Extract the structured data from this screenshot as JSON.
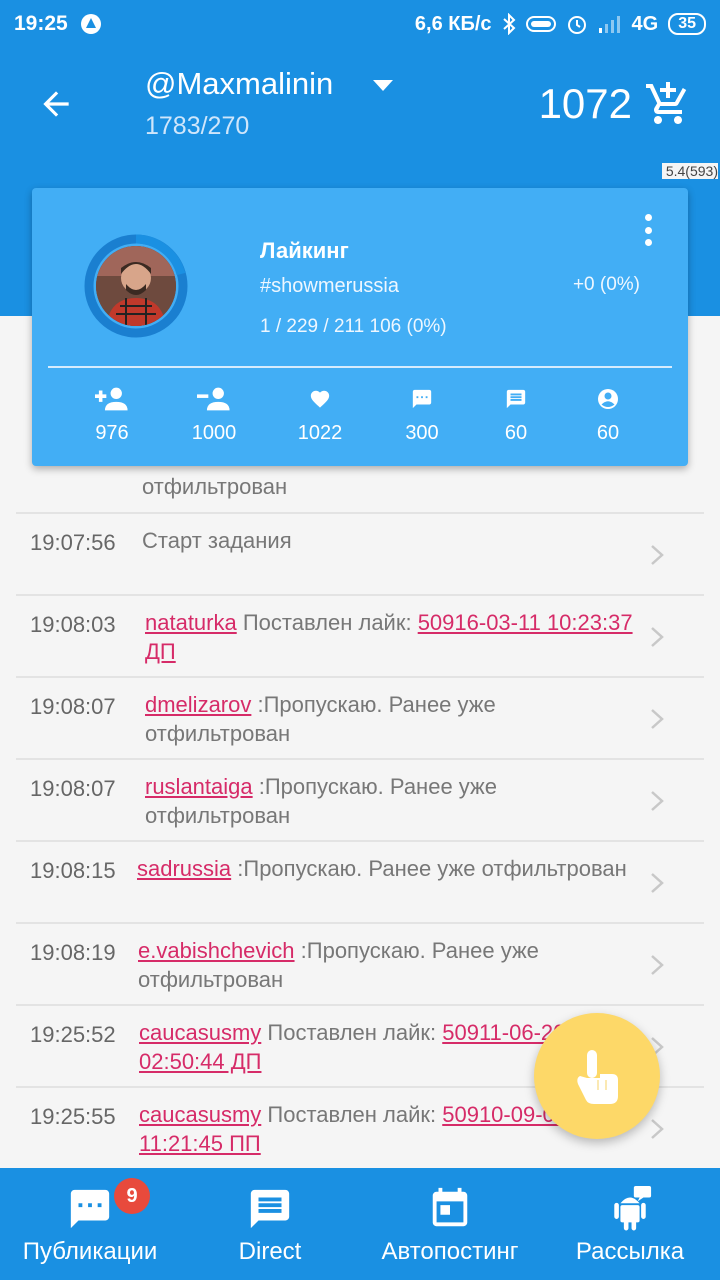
{
  "status_bar": {
    "time": "19:25",
    "network_speed": "6,6 КБ/с",
    "network_type": "4G",
    "battery": "35"
  },
  "header": {
    "account": "@Maxmalinin",
    "followers_following": "1783/270",
    "balance": "1072",
    "version": "5.4(593)"
  },
  "task_card": {
    "title": "Лайкинг",
    "tag": "#showmerussia",
    "delta": "+0 (0%)",
    "progress": "1 / 229 / 211 106 (0%)",
    "stats": [
      {
        "icon": "follow-add-icon",
        "value": "976"
      },
      {
        "icon": "follow-remove-icon",
        "value": "1000"
      },
      {
        "icon": "heart-icon",
        "value": "1022"
      },
      {
        "icon": "comment-icon",
        "value": "300"
      },
      {
        "icon": "message-icon",
        "value": "60"
      },
      {
        "icon": "profile-icon",
        "value": "60"
      }
    ]
  },
  "log": {
    "partial_text": "отфильтрован",
    "rows": [
      {
        "time": "19:07:56",
        "user": "",
        "text": "Старт задания",
        "link": ""
      },
      {
        "time": "19:08:03",
        "user": "nataturka",
        "text": " Поставлен лайк: ",
        "link": "50916-03-11 10:23:37 ДП"
      },
      {
        "time": "19:08:07",
        "user": "dmelizarov",
        "text": " :Пропускаю. Ранее уже отфильтрован",
        "link": ""
      },
      {
        "time": "19:08:07",
        "user": "ruslantaiga",
        "text": " :Пропускаю. Ранее уже отфильтрован",
        "link": ""
      },
      {
        "time": "19:08:15",
        "user": "sadrussia",
        "text": " :Пропускаю. Ранее уже отфильтрован",
        "link": ""
      },
      {
        "time": "19:08:19",
        "user": "e.vabishchevich",
        "text": " :Пропускаю. Ранее уже отфильтрован",
        "link": ""
      },
      {
        "time": "19:25:52",
        "user": "caucasusmy",
        "text": " Поставлен лайк: ",
        "link": "50911-06-20 02:50:44 ДП"
      },
      {
        "time": "19:25:55",
        "user": "caucasusmy",
        "text": " Поставлен лайк: ",
        "link": "50910-09-08 11:21:45 ПП"
      }
    ]
  },
  "bottom_nav": [
    {
      "label": "Публикации",
      "icon": "chat-icon",
      "badge": "9"
    },
    {
      "label": "Direct",
      "icon": "message-icon",
      "badge": ""
    },
    {
      "label": "Автопостинг",
      "icon": "calendar-icon",
      "badge": ""
    },
    {
      "label": "Рассылка",
      "icon": "android-icon",
      "badge": ""
    }
  ],
  "colors": {
    "primary": "#1a90e2",
    "card": "#42aef5",
    "link": "#d62b68",
    "fab": "#fdd868",
    "badge": "#e84a3c"
  }
}
